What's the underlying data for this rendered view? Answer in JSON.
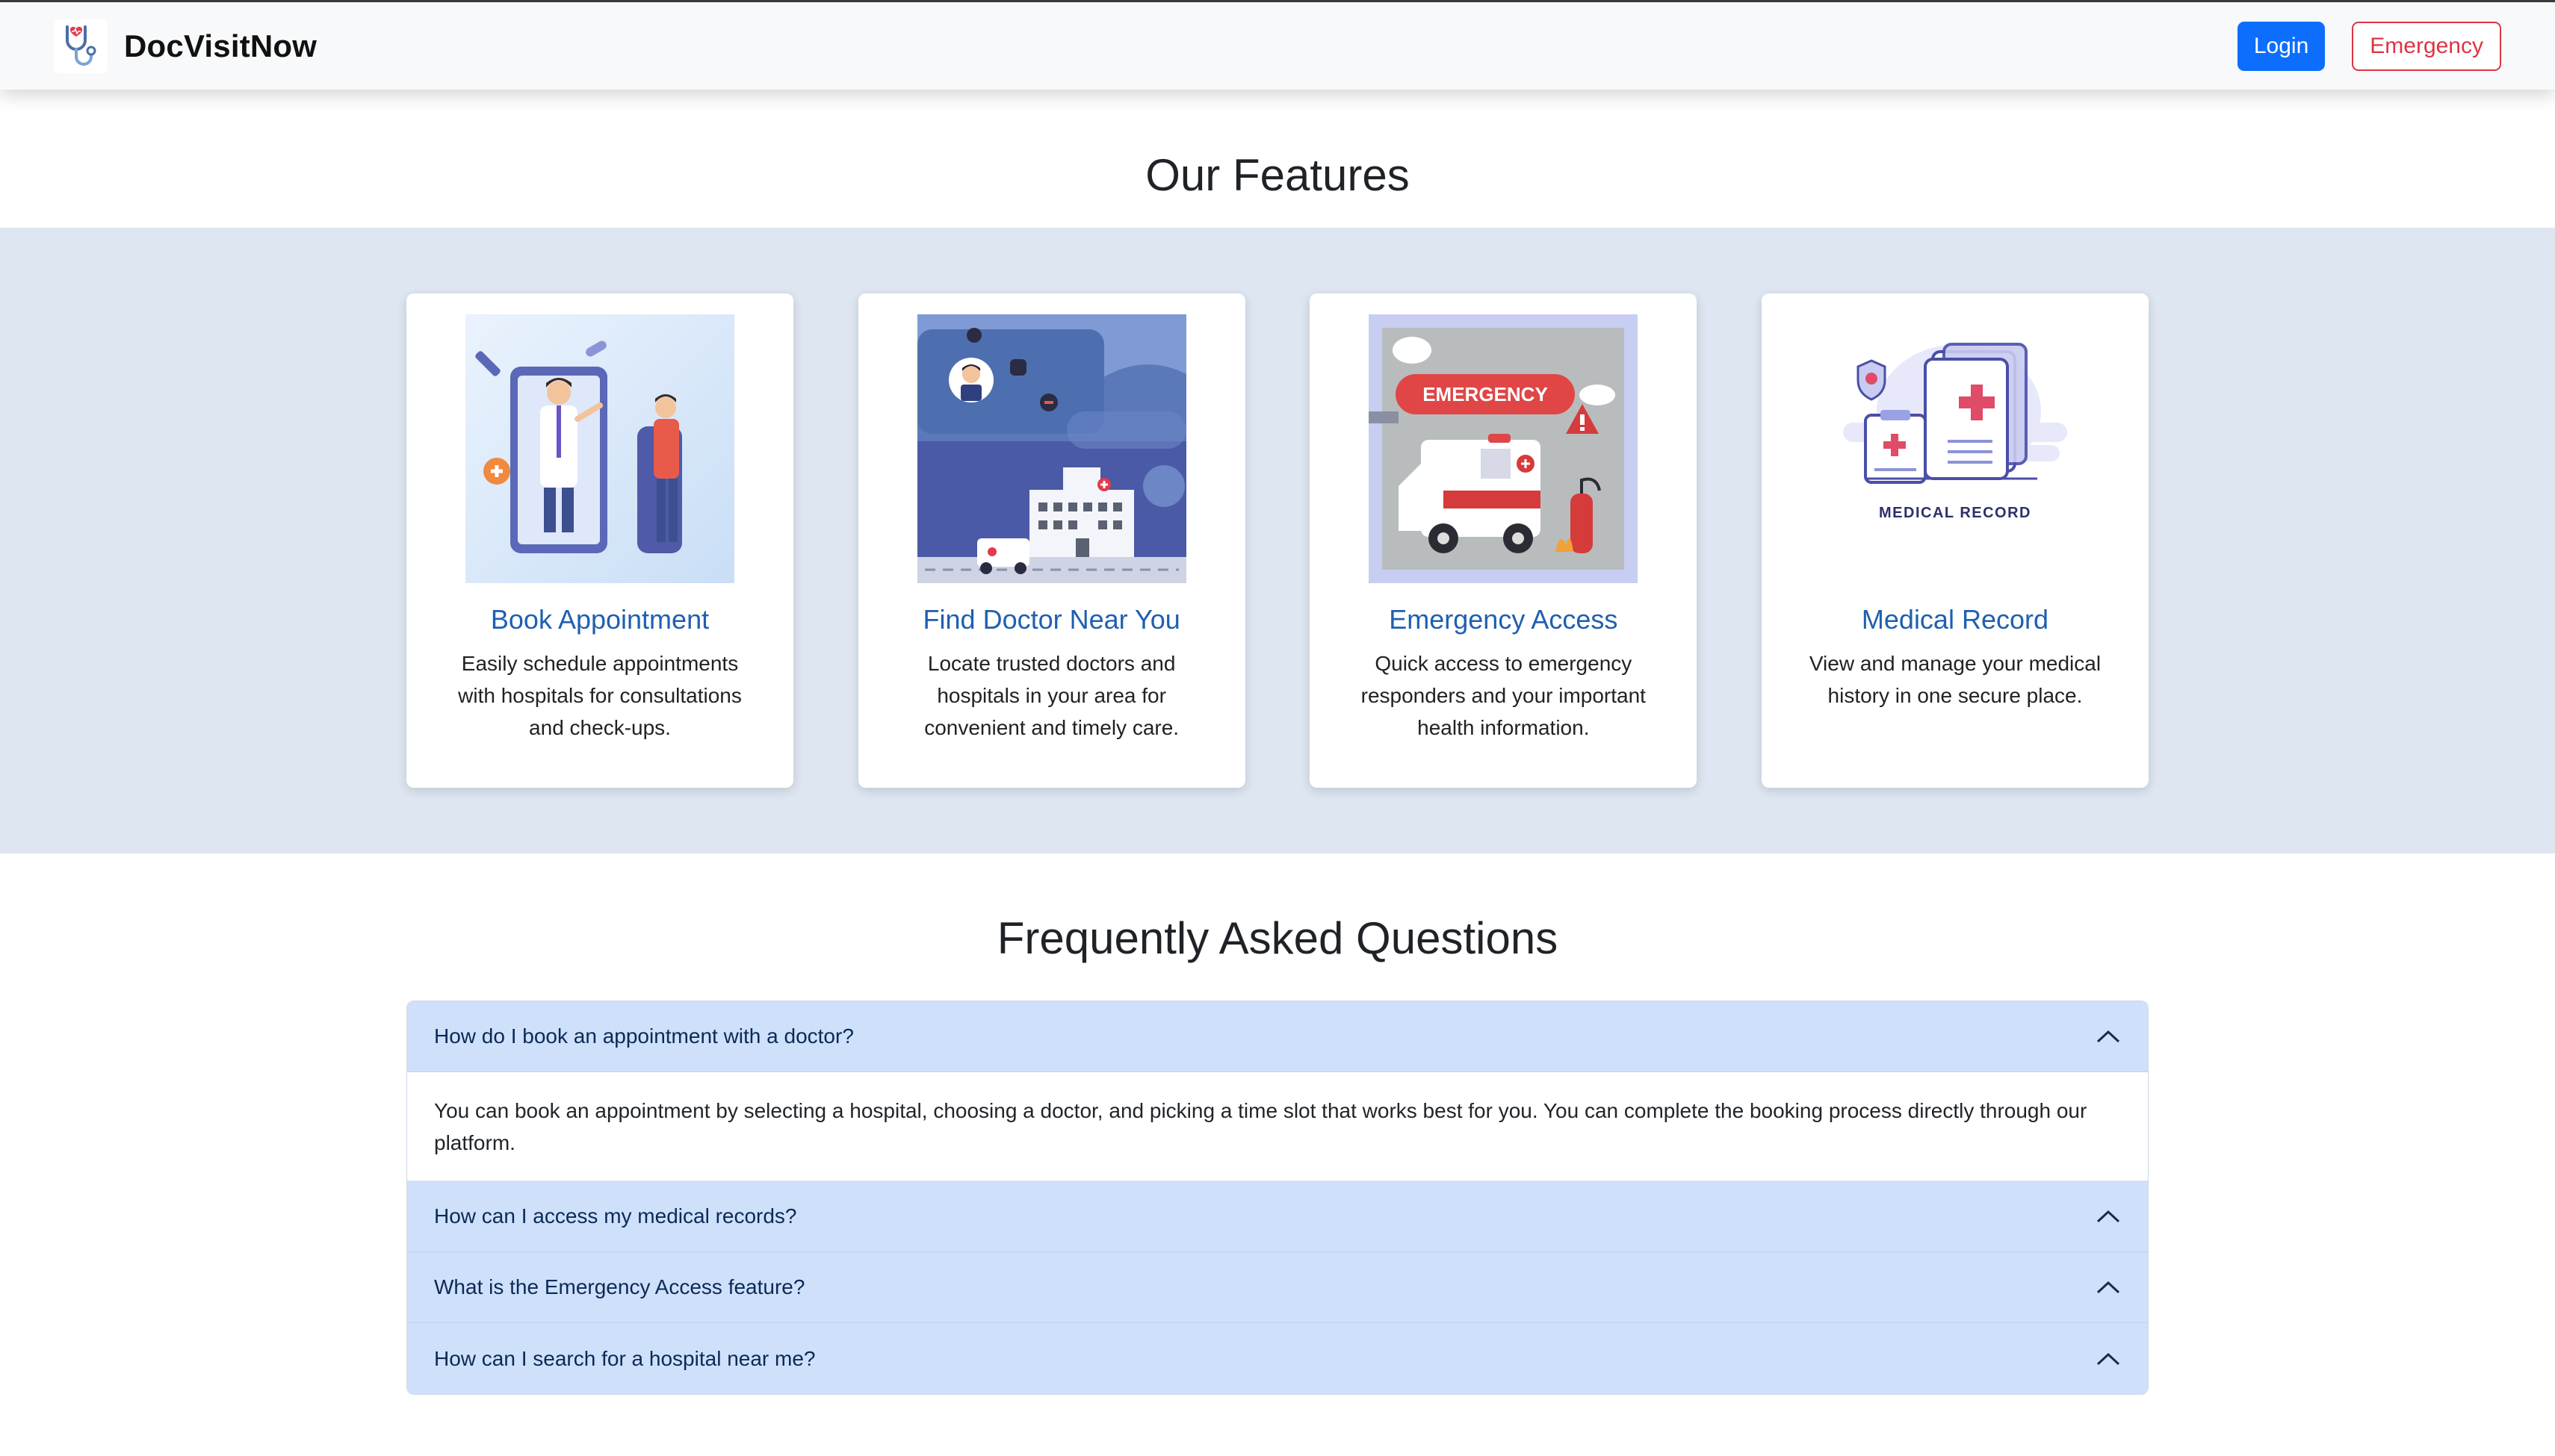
{
  "brand": {
    "name": "DocVisitNow"
  },
  "nav": {
    "login_label": "Login",
    "emergency_label": "Emergency"
  },
  "features": {
    "title": "Our Features",
    "cards": [
      {
        "title": "Book Appointment",
        "desc": "Easily schedule appointments with hospitals for consultations and check-ups.",
        "icon": "doctor-appointment-illustration"
      },
      {
        "title": "Find Doctor Near You",
        "desc": "Locate trusted doctors and hospitals in your area for convenient and timely care.",
        "icon": "hospital-map-illustration"
      },
      {
        "title": "Emergency Access",
        "desc": "Quick access to emergency responders and your important health information.",
        "icon": "ambulance-emergency-illustration",
        "image_text": "EMERGENCY"
      },
      {
        "title": "Medical Record",
        "desc": "View and manage your medical history in one secure place.",
        "icon": "medical-record-illustration",
        "image_text": "MEDICAL RECORD"
      }
    ]
  },
  "faq": {
    "title": "Frequently Asked Questions",
    "items": [
      {
        "q": "How do I book an appointment with a doctor?",
        "a": "You can book an appointment by selecting a hospital, choosing a doctor, and picking a time slot that works best for you. You can complete the booking process directly through our platform.",
        "expanded": true
      },
      {
        "q": "How can I access my medical records?",
        "expanded": false
      },
      {
        "q": "What is the Emergency Access feature?",
        "expanded": false
      },
      {
        "q": "How can I search for a hospital near me?",
        "expanded": false
      }
    ]
  },
  "colors": {
    "primary": "#0d6efd",
    "danger": "#dc3545",
    "band": "#dde6f1",
    "accordion_header": "#cfe0fb",
    "card_title": "#1f5fb0"
  }
}
